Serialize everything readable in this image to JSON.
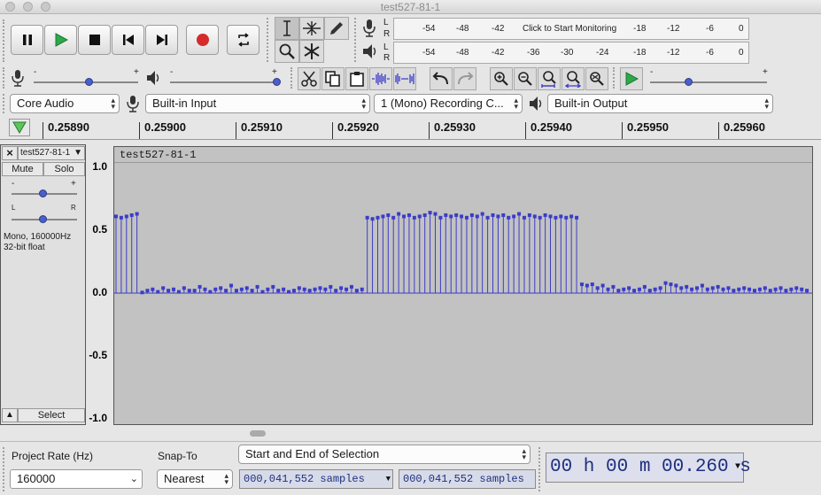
{
  "window": {
    "title": "test527-81-1"
  },
  "meters": {
    "record_scale": [
      "-54",
      "-48",
      "-42",
      "Click to Start Monitoring",
      "-18",
      "-12",
      "-6",
      "0"
    ],
    "play_scale": [
      "-54",
      "-48",
      "-42",
      "-36",
      "-30",
      "-24",
      "-18",
      "-12",
      "-6",
      "0"
    ],
    "channel_left": "L",
    "channel_right": "R"
  },
  "slider_marks": {
    "minus": "-",
    "plus": "+",
    "left": "L",
    "right": "R"
  },
  "device": {
    "host": "Core Audio",
    "input": "Built-in Input",
    "channels": "1 (Mono) Recording C...",
    "output": "Built-in Output"
  },
  "ruler": {
    "ticks": [
      "0.25890",
      "0.25900",
      "0.25910",
      "0.25920",
      "0.25930",
      "0.25940",
      "0.25950",
      "0.25960"
    ]
  },
  "track": {
    "name": "test527-81-1",
    "close": "×",
    "mute_label": "Mute",
    "solo_label": "Solo",
    "info_line1": "Mono, 160000Hz",
    "info_line2": "32-bit float",
    "select_label": "Select"
  },
  "waveform": {
    "y_labels": [
      "1.0",
      "0.5",
      "0.0",
      "-0.5",
      "-1.0"
    ],
    "samples": [
      0.61,
      0.6,
      0.61,
      0.62,
      0.63,
      0.005,
      0.02,
      0.03,
      0.01,
      0.04,
      0.02,
      0.03,
      0.01,
      0.04,
      0.02,
      0.02,
      0.05,
      0.03,
      0.01,
      0.03,
      0.04,
      0.02,
      0.06,
      0.02,
      0.03,
      0.04,
      0.02,
      0.05,
      0.01,
      0.03,
      0.05,
      0.02,
      0.03,
      0.01,
      0.02,
      0.04,
      0.03,
      0.02,
      0.03,
      0.04,
      0.03,
      0.05,
      0.02,
      0.04,
      0.03,
      0.05,
      0.02,
      0.03,
      0.6,
      0.59,
      0.6,
      0.61,
      0.62,
      0.6,
      0.63,
      0.61,
      0.62,
      0.6,
      0.61,
      0.62,
      0.64,
      0.63,
      0.6,
      0.62,
      0.61,
      0.62,
      0.61,
      0.6,
      0.62,
      0.61,
      0.63,
      0.6,
      0.62,
      0.61,
      0.62,
      0.6,
      0.61,
      0.63,
      0.6,
      0.62,
      0.61,
      0.6,
      0.62,
      0.61,
      0.6,
      0.61,
      0.6,
      0.61,
      0.6,
      0.07,
      0.06,
      0.07,
      0.04,
      0.06,
      0.03,
      0.05,
      0.02,
      0.03,
      0.04,
      0.02,
      0.03,
      0.05,
      0.02,
      0.03,
      0.04,
      0.08,
      0.07,
      0.06,
      0.04,
      0.05,
      0.03,
      0.04,
      0.06,
      0.03,
      0.04,
      0.05,
      0.03,
      0.04,
      0.02,
      0.03,
      0.04,
      0.03,
      0.02,
      0.03,
      0.04,
      0.02,
      0.03,
      0.04,
      0.02,
      0.03,
      0.04,
      0.03,
      0.02
    ]
  },
  "bottom": {
    "project_rate_label": "Project Rate (Hz)",
    "project_rate_value": "160000",
    "snap_label": "Snap-To",
    "snap_value": "Nearest",
    "selection_mode": "Start and End of Selection",
    "selection_start": "000,041,552 samples",
    "selection_end": "000,041,552 samples",
    "time_display": "00 h 00 m 00.260 s"
  },
  "colors": {
    "wave_blue": "#3c3cc8",
    "record_red": "#d52b2b",
    "play_green": "#2ea84a",
    "wave_bg": "#c2c2c2"
  }
}
